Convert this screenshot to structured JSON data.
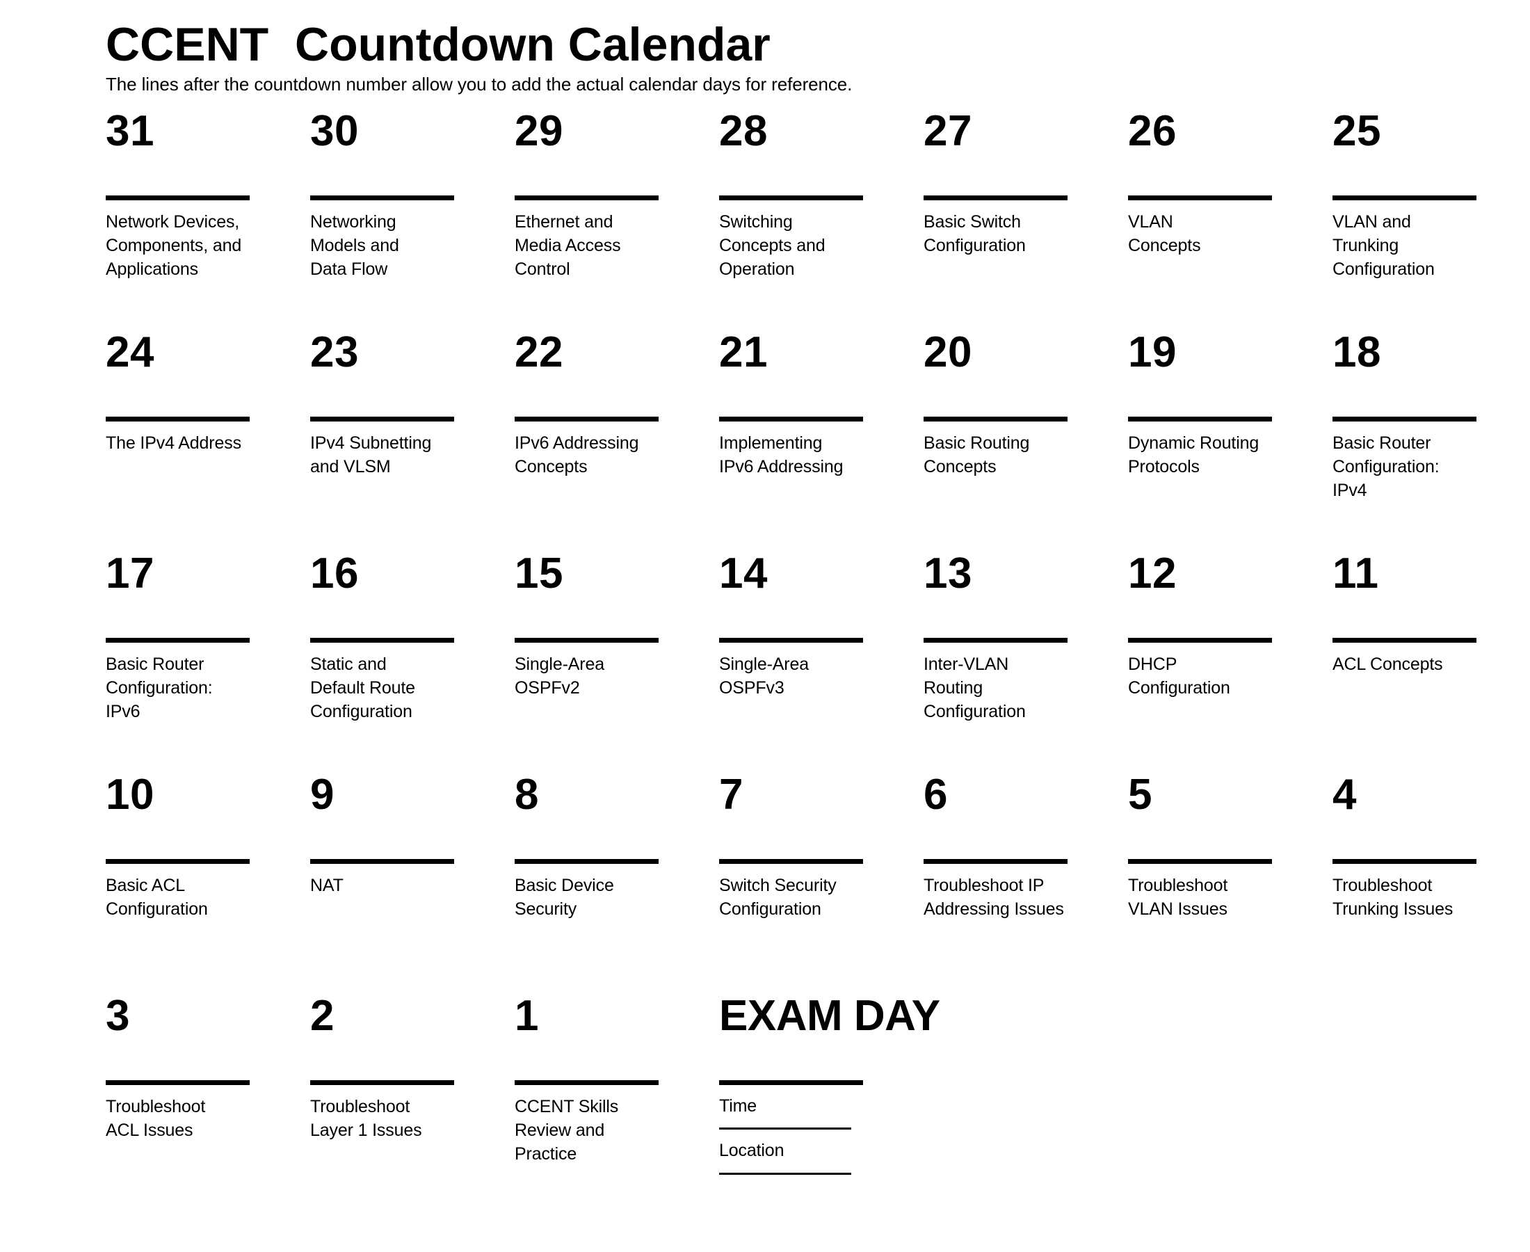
{
  "header": {
    "title": "CCENT  Countdown Calendar",
    "subtitle": "The lines after the countdown number allow you to add the actual calendar days for reference."
  },
  "calendar": {
    "columns": 7,
    "cells": [
      {
        "number": "31",
        "topic": "Network Devices,\nComponents, and\nApplications"
      },
      {
        "number": "30",
        "topic": "Networking\nModels and\nData Flow"
      },
      {
        "number": "29",
        "topic": "Ethernet and\nMedia Access\nControl"
      },
      {
        "number": "28",
        "topic": "Switching\nConcepts and\nOperation"
      },
      {
        "number": "27",
        "topic": "Basic Switch\nConfiguration"
      },
      {
        "number": "26",
        "topic": "VLAN\nConcepts"
      },
      {
        "number": "25",
        "topic": "VLAN and\nTrunking\nConfiguration"
      },
      {
        "number": "24",
        "topic": "The IPv4 Address"
      },
      {
        "number": "23",
        "topic": "IPv4 Subnetting\nand VLSM"
      },
      {
        "number": "22",
        "topic": "IPv6 Addressing\nConcepts"
      },
      {
        "number": "21",
        "topic": "Implementing\nIPv6 Addressing"
      },
      {
        "number": "20",
        "topic": "Basic Routing\nConcepts"
      },
      {
        "number": "19",
        "topic": "Dynamic Routing\nProtocols"
      },
      {
        "number": "18",
        "topic": "Basic Router\nConfiguration:\nIPv4"
      },
      {
        "number": "17",
        "topic": "Basic Router\nConfiguration:\nIPv6"
      },
      {
        "number": "16",
        "topic": "Static and\nDefault Route\nConfiguration"
      },
      {
        "number": "15",
        "topic": "Single-Area\nOSPFv2"
      },
      {
        "number": "14",
        "topic": "Single-Area\nOSPFv3"
      },
      {
        "number": "13",
        "topic": "Inter-VLAN\nRouting\nConfiguration"
      },
      {
        "number": "12",
        "topic": "DHCP\nConfiguration"
      },
      {
        "number": "11",
        "topic": "ACL Concepts"
      },
      {
        "number": "10",
        "topic": "Basic ACL\nConfiguration"
      },
      {
        "number": "9",
        "topic": "NAT"
      },
      {
        "number": "8",
        "topic": "Basic Device\nSecurity"
      },
      {
        "number": "7",
        "topic": "Switch Security\nConfiguration"
      },
      {
        "number": "6",
        "topic": "Troubleshoot IP\nAddressing Issues"
      },
      {
        "number": "5",
        "topic": "Troubleshoot\nVLAN Issues"
      },
      {
        "number": "4",
        "topic": "Troubleshoot\nTrunking Issues"
      },
      {
        "number": "3",
        "topic": "Troubleshoot\nACL Issues"
      },
      {
        "number": "2",
        "topic": "Troubleshoot\nLayer 1 Issues"
      },
      {
        "number": "1",
        "topic": "CCENT Skills\nReview and\nPractice"
      },
      {
        "number": "EXAM DAY",
        "is_exam_day": true,
        "fields": [
          {
            "label": "Time"
          },
          {
            "label": "Location"
          }
        ]
      }
    ]
  },
  "colors": {
    "ink": "#000000",
    "paper": "#ffffff"
  }
}
